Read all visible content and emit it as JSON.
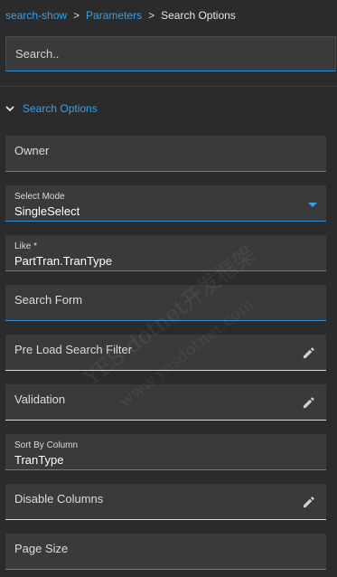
{
  "breadcrumb": {
    "items": [
      "search-show",
      "Parameters"
    ],
    "separator": ">",
    "current": "Search Options"
  },
  "search": {
    "placeholder": "Search.."
  },
  "section": {
    "title": "Search Options",
    "expanded": true
  },
  "fields": {
    "owner": {
      "label": "Owner"
    },
    "select_mode": {
      "label": "Select Mode",
      "value": "SingleSelect"
    },
    "like": {
      "label": "Like *",
      "value": "PartTran.TranType"
    },
    "search_form": {
      "label": "Search Form"
    },
    "pre_load_search_filter": {
      "label": "Pre Load Search Filter"
    },
    "validation": {
      "label": "Validation"
    },
    "sort_by_column": {
      "label": "Sort By Column",
      "value": "TranType"
    },
    "disable_columns": {
      "label": "Disable Columns"
    },
    "page_size": {
      "label": "Page Size"
    }
  },
  "watermark": {
    "line1": "YES dotnet开发框架",
    "line2": "www.yesdotnet.com"
  },
  "colors": {
    "accent": "#3aa0e6",
    "background": "#2b2b2b",
    "field": "#3a3a3a"
  },
  "icons": {
    "edit": "pencil-icon",
    "collapse": "chevron-down-icon",
    "dropdown": "caret-down-icon"
  }
}
